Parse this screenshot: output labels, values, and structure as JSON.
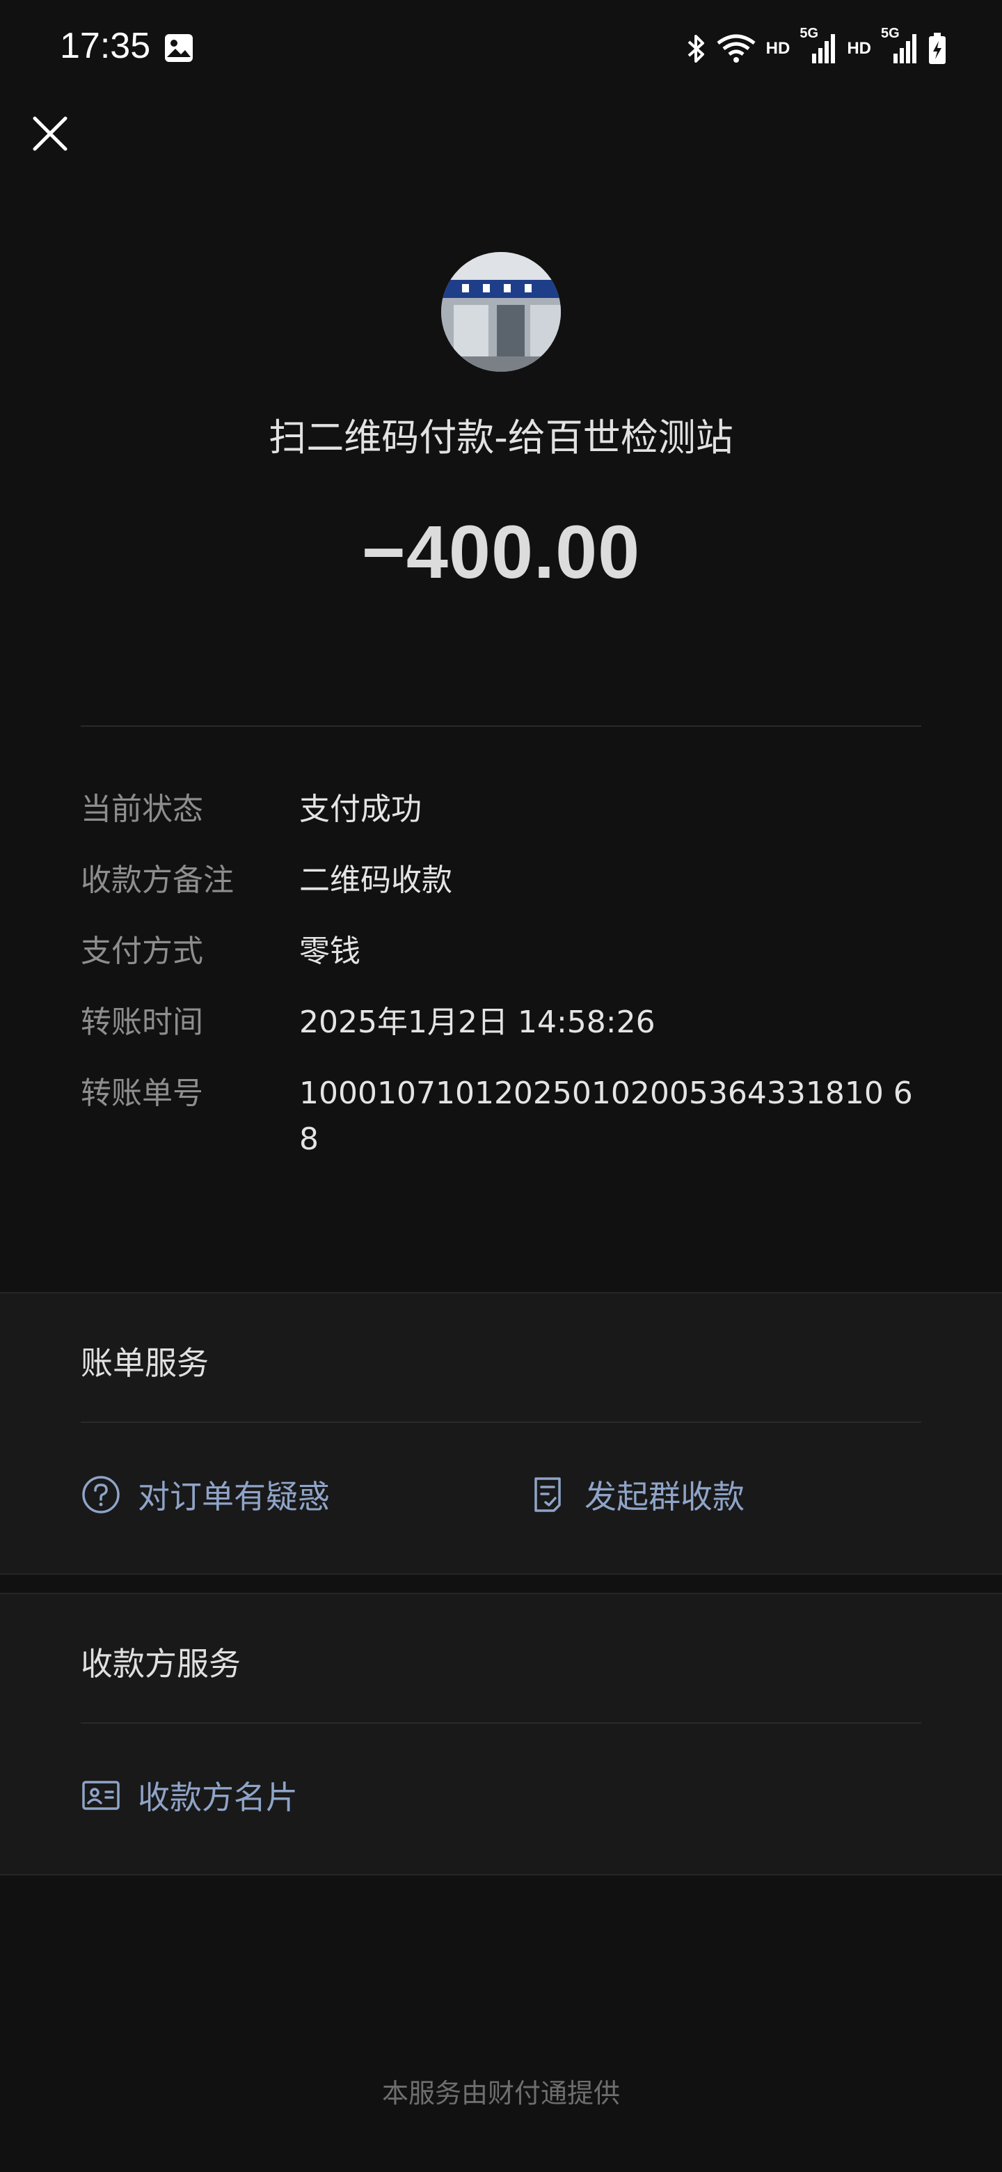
{
  "status_bar": {
    "time": "17:35",
    "hd_1": "HD",
    "network_1": "5G",
    "hd_2": "HD",
    "network_2": "5G"
  },
  "header": {
    "close_icon": "close-icon"
  },
  "payment": {
    "merchant_title": "扫二维码付款-给百世检测站",
    "amount": "−400.00"
  },
  "details": [
    {
      "label": "当前状态",
      "value": "支付成功"
    },
    {
      "label": "收款方备注",
      "value": "二维码收款"
    },
    {
      "label": "支付方式",
      "value": "零钱"
    },
    {
      "label": "转账时间",
      "value": "2025年1月2日 14:58:26"
    },
    {
      "label": "转账单号",
      "value": "100010710120250102005364331810 68"
    }
  ],
  "bill_service": {
    "title": "账单服务",
    "items": [
      {
        "label": "对订单有疑惑",
        "icon": "question-circle-icon"
      },
      {
        "label": "发起群收款",
        "icon": "receipt-icon"
      }
    ]
  },
  "payee_service": {
    "title": "收款方服务",
    "items": [
      {
        "label": "收款方名片",
        "icon": "contact-card-icon"
      }
    ]
  },
  "footer": {
    "text": "本服务由财付通提供"
  },
  "colors": {
    "background": "#111111",
    "section_background": "#191919",
    "link_blue": "#8fa4c8"
  }
}
